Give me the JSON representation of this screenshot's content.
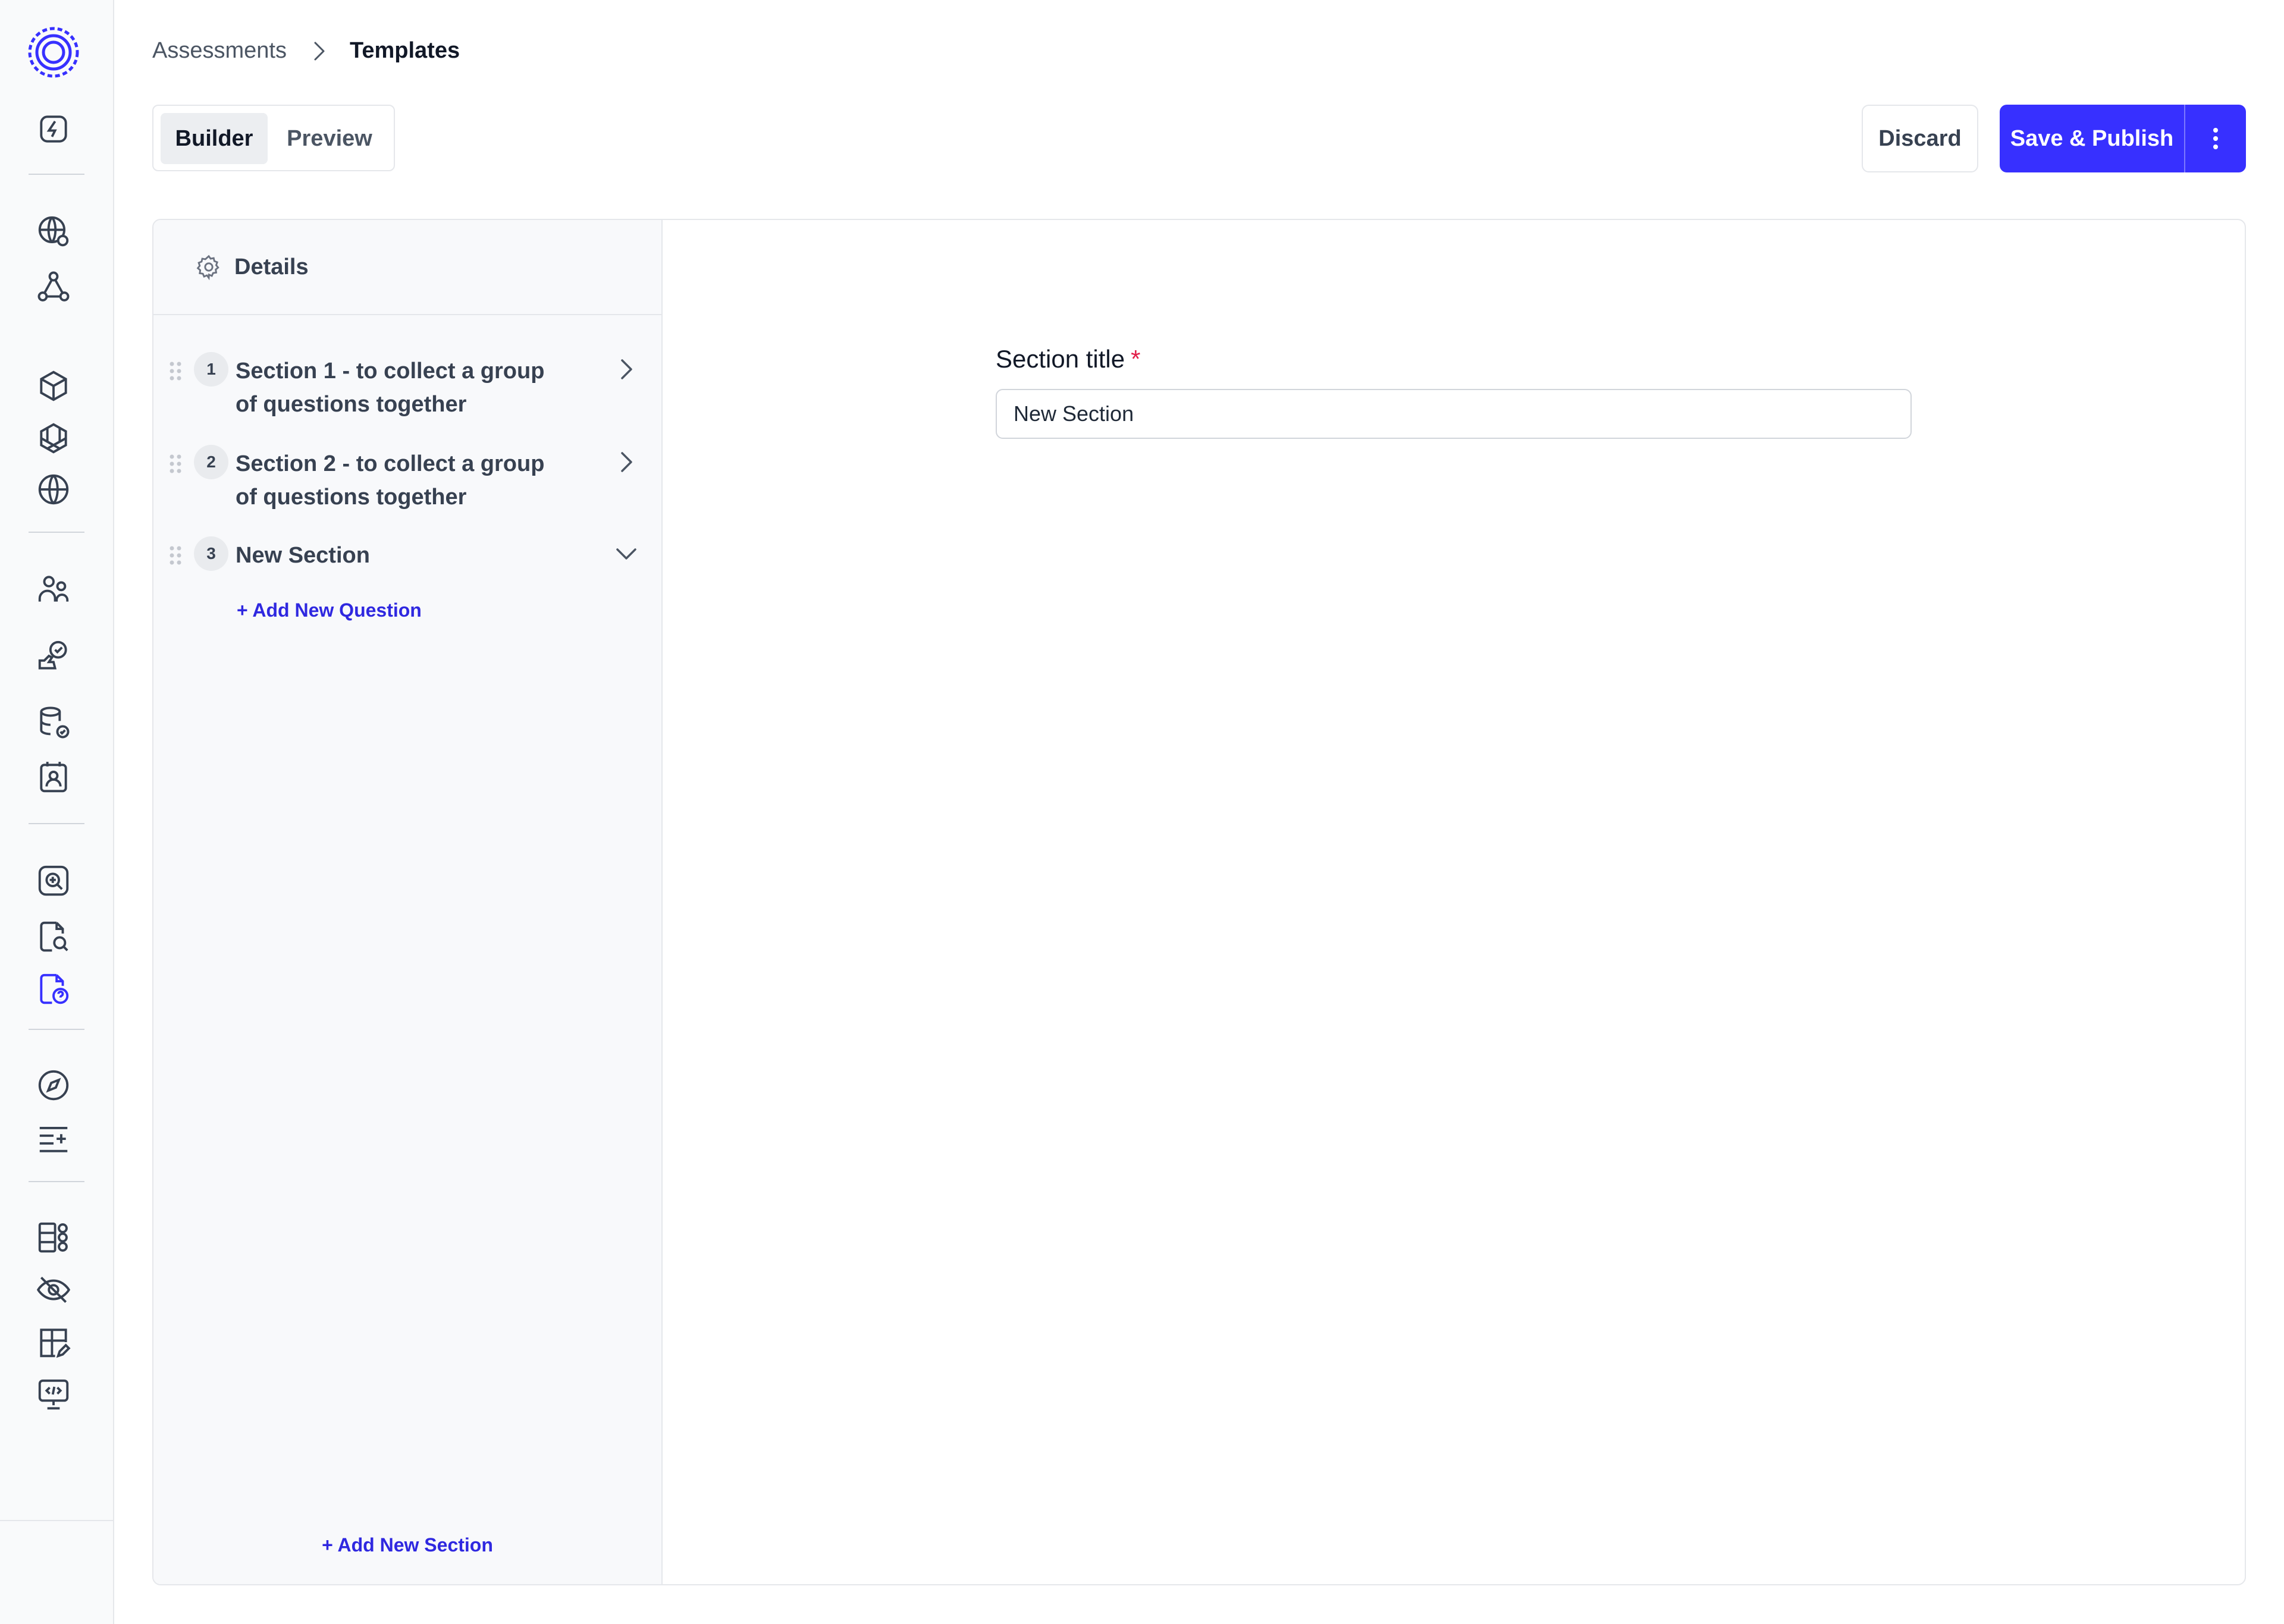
{
  "breadcrumb": {
    "parent": "Assessments",
    "current": "Templates"
  },
  "tabs": {
    "builder": "Builder",
    "preview": "Preview"
  },
  "actions": {
    "discard": "Discard",
    "publish": "Save & Publish"
  },
  "details_label": "Details",
  "sections": [
    {
      "number": "1",
      "title": "Section 1 - to collect a group of questions together",
      "expanded": false
    },
    {
      "number": "2",
      "title": "Section 2 - to collect a group of questions together",
      "expanded": false
    },
    {
      "number": "3",
      "title": "New Section",
      "expanded": true
    }
  ],
  "add_question": "+ Add New Question",
  "add_section": "+ Add New Section",
  "form": {
    "label": "Section title",
    "required_mark": "*",
    "value": "New Section"
  },
  "colors": {
    "primary": "#3730ff",
    "link": "#2f28e0",
    "required": "#e11d48"
  }
}
